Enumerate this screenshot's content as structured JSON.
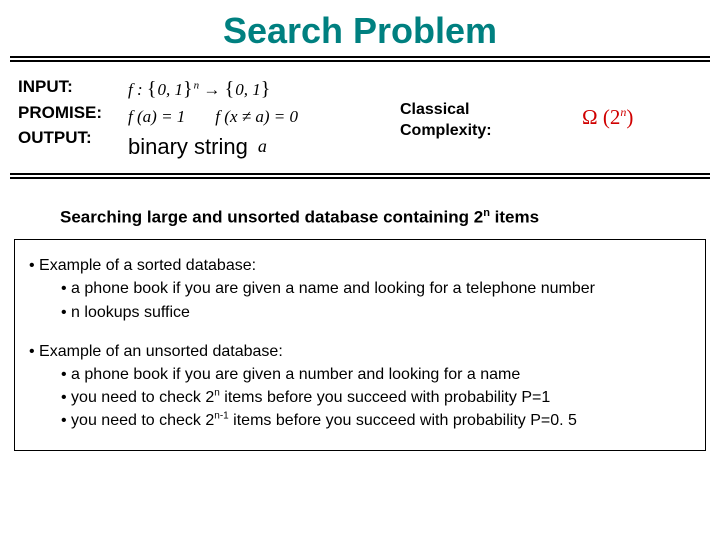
{
  "title": "Search Problem",
  "definitions": {
    "input_label": "INPUT:",
    "promise_label": "PROMISE:",
    "output_label": "OUTPUT:",
    "input_formula": "f : {0, 1}ⁿ → {0, 1}",
    "promise_formula_1": "f (a) = 1",
    "promise_formula_2": "f (x ≠ a) = 0",
    "output_text": "binary string",
    "output_var": "a"
  },
  "classical": {
    "line1": "Classical",
    "line2": "Complexity:",
    "omega": "Ω (2",
    "omega_exp": "n",
    "omega_close": ")"
  },
  "subtitle_pre": "Searching large and unsorted database containing 2",
  "subtitle_exp": "n",
  "subtitle_post": " items",
  "box": {
    "sorted": {
      "lead": "• Example of a sorted database:",
      "b1": "• a phone book if you are given a name and looking for a telephone number",
      "b2": "• n lookups suffice"
    },
    "unsorted": {
      "lead": "• Example of an unsorted database:",
      "b1": "• a phone book if you are given a number and looking for a name",
      "b2_pre": "• you need to check 2",
      "b2_exp": "n",
      "b2_post": " items before you succeed with probability P=1",
      "b3_pre": "• you need to check 2",
      "b3_exp": "n-1",
      "b3_post": " items before you succeed with probability P=0. 5"
    }
  }
}
